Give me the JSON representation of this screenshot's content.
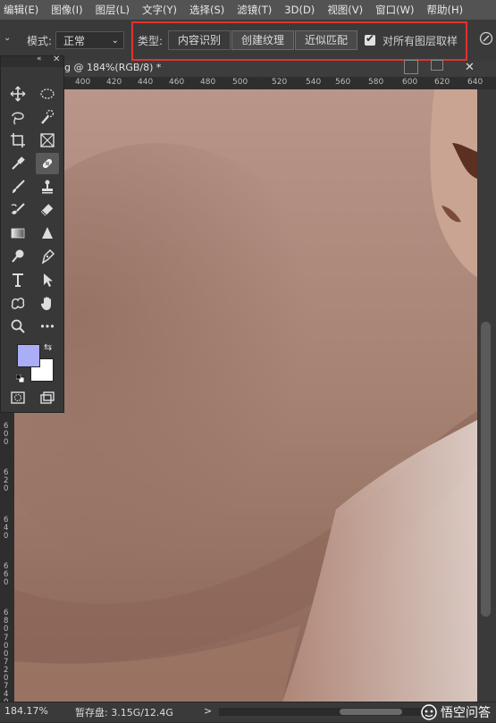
{
  "menu": [
    "编辑(E)",
    "图像(I)",
    "图层(L)",
    "文字(Y)",
    "选择(S)",
    "滤镜(T)",
    "3D(D)",
    "视图(V)",
    "窗口(W)",
    "帮助(H)"
  ],
  "options": {
    "mode_label": "模式:",
    "mode_value": "正常",
    "type_label": "类型:",
    "type_buttons": [
      "内容识别",
      "创建纹理",
      "近似匹配"
    ],
    "sample_all_layers_label": "对所有图层取样",
    "sample_all_layers_checked": true
  },
  "document": {
    "tab_title": "g @ 184%(RGB/8) *"
  },
  "ruler": {
    "horizontal_ticks": [
      "400",
      "420",
      "440",
      "460",
      "480",
      "500",
      "520",
      "540",
      "560",
      "580",
      "600",
      "620",
      "640"
    ],
    "vertical_labels": [
      "6",
      "0",
      "0",
      "6",
      "2",
      "0",
      "6",
      "4",
      "0",
      "6",
      "6",
      "0",
      "6",
      "8",
      "0",
      "7",
      "0",
      "0",
      "7",
      "2",
      "0",
      "7",
      "4",
      "0"
    ]
  },
  "status": {
    "zoom": "184.17%",
    "scratch": "暂存盘: 3.15G/12.4G",
    "arrow": ">"
  },
  "watermark": {
    "text": "悟空问答"
  },
  "colors": {
    "foreground": "#a9aef7",
    "background": "#ffffff",
    "highlight_border": "#e2322e",
    "skin_base": "#a58272"
  },
  "tools": [
    "move",
    "marquee",
    "lasso",
    "quick-select",
    "crop",
    "frame",
    "eyedropper",
    "spot-healing",
    "brush",
    "clone-stamp",
    "history-brush",
    "eraser",
    "gradient",
    "blur",
    "dodge",
    "pen",
    "type",
    "path-select",
    "shape",
    "hand",
    "zoom",
    "more"
  ]
}
